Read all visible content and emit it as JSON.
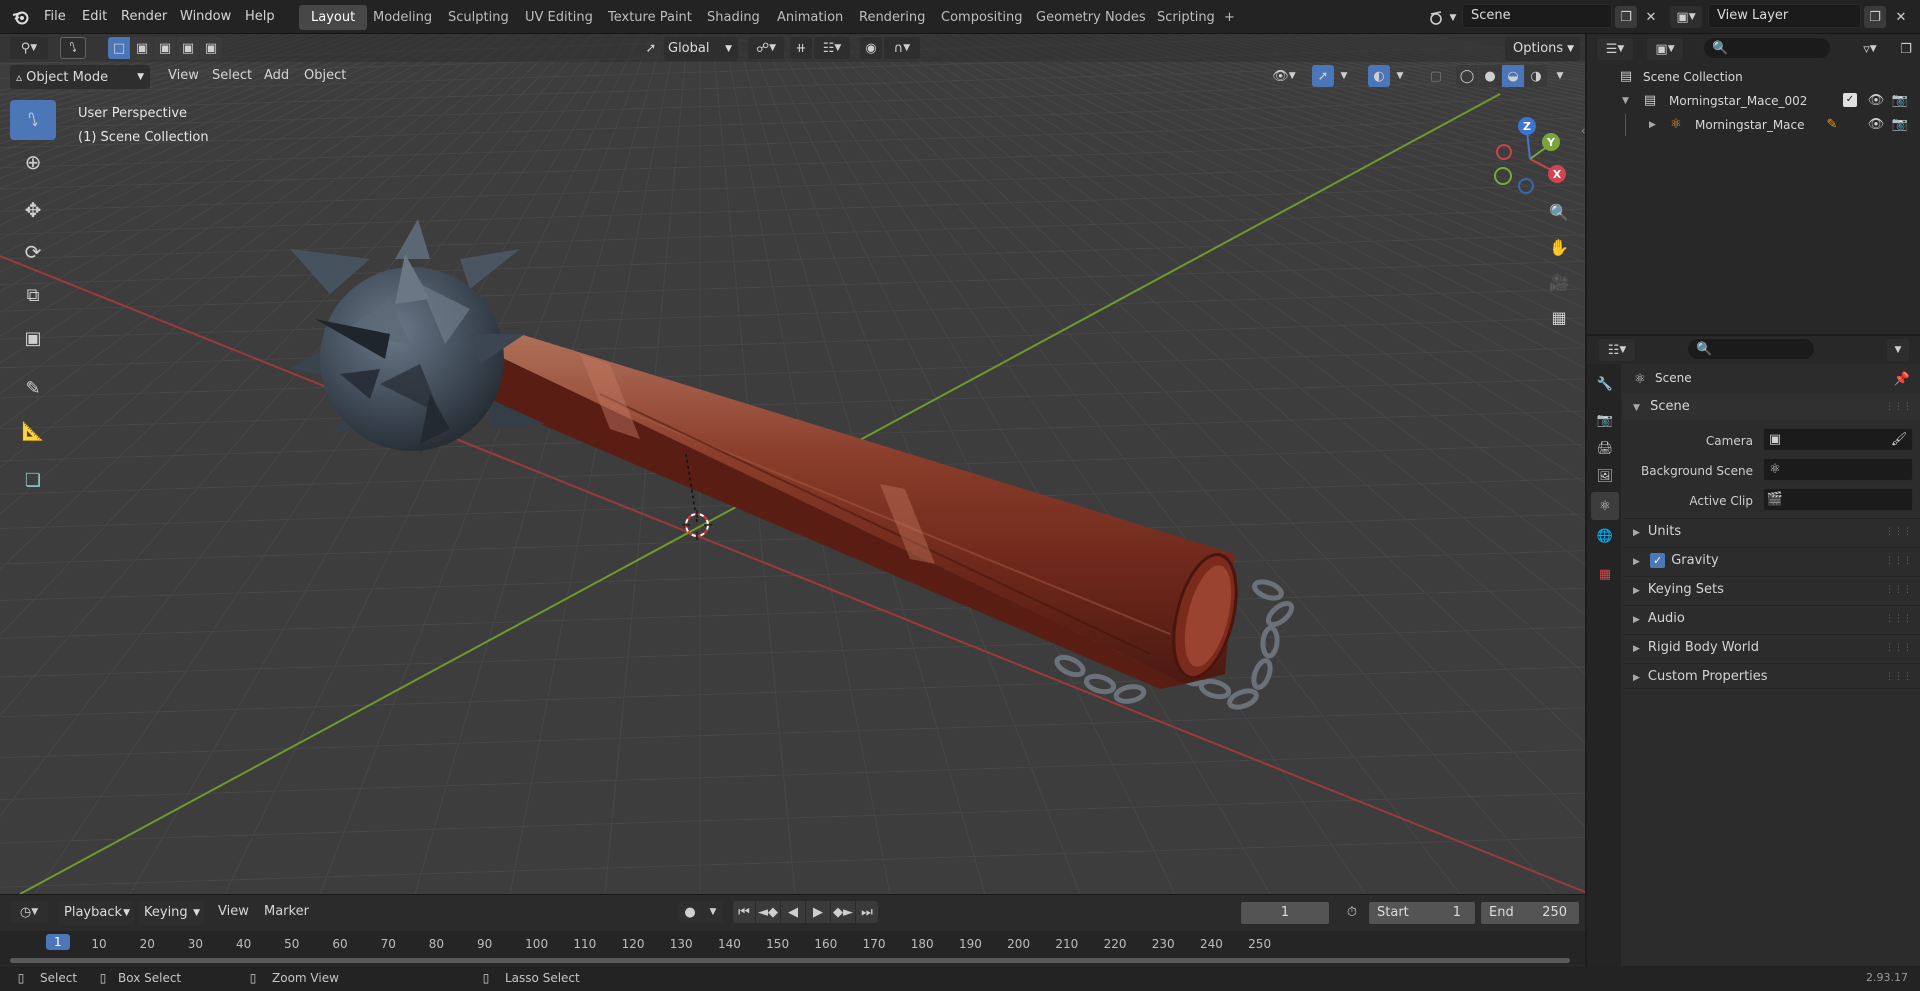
{
  "topbar": {
    "menus": [
      "File",
      "Edit",
      "Render",
      "Window",
      "Help"
    ],
    "workspaces": [
      "Layout",
      "Modeling",
      "Sculpting",
      "UV Editing",
      "Texture Paint",
      "Shading",
      "Animation",
      "Rendering",
      "Compositing",
      "Geometry Nodes",
      "Scripting"
    ],
    "active_workspace": "Layout",
    "add_tab": "+",
    "scene_name": "Scene",
    "view_layer_name": "View Layer"
  },
  "viewport": {
    "mode": "Object Mode",
    "menus": [
      "View",
      "Select",
      "Add",
      "Object"
    ],
    "orientation": "Global",
    "options_label": "Options",
    "overlay_title": "User Perspective",
    "overlay_collection": "(1) Scene Collection",
    "gizmo_axes": [
      "X",
      "Y",
      "Z"
    ],
    "colors": {
      "x_axis": "#9b3a3a",
      "y_axis": "#6e9a2e",
      "grid": "#474747",
      "background": "#3d3d3d"
    }
  },
  "outliner": {
    "root": "Scene Collection",
    "items": [
      {
        "label": "Morningstar_Mace_002",
        "depth": 1
      },
      {
        "label": "Morningstar_Mace",
        "depth": 2
      }
    ]
  },
  "properties": {
    "context_title": "Scene",
    "section": "Scene",
    "fields": [
      {
        "label": "Camera",
        "value": ""
      },
      {
        "label": "Background Scene",
        "value": ""
      },
      {
        "label": "Active Clip",
        "value": ""
      }
    ],
    "panels": [
      "Units",
      "Gravity",
      "Keying Sets",
      "Audio",
      "Rigid Body World",
      "Custom Properties"
    ],
    "gravity_checked": true
  },
  "timeline": {
    "menus": [
      "Playback",
      "Keying",
      "View",
      "Marker"
    ],
    "current_frame": "1",
    "start_label": "Start",
    "start_value": "1",
    "end_label": "End",
    "end_value": "250",
    "ruler": [
      "1",
      "10",
      "20",
      "30",
      "40",
      "50",
      "60",
      "70",
      "80",
      "90",
      "100",
      "110",
      "120",
      "130",
      "140",
      "150",
      "160",
      "170",
      "180",
      "190",
      "200",
      "210",
      "220",
      "230",
      "240",
      "250"
    ]
  },
  "statusbar": {
    "items": [
      "Select",
      "Box Select",
      "Zoom View",
      "Lasso Select"
    ],
    "version": "2.93.17"
  }
}
